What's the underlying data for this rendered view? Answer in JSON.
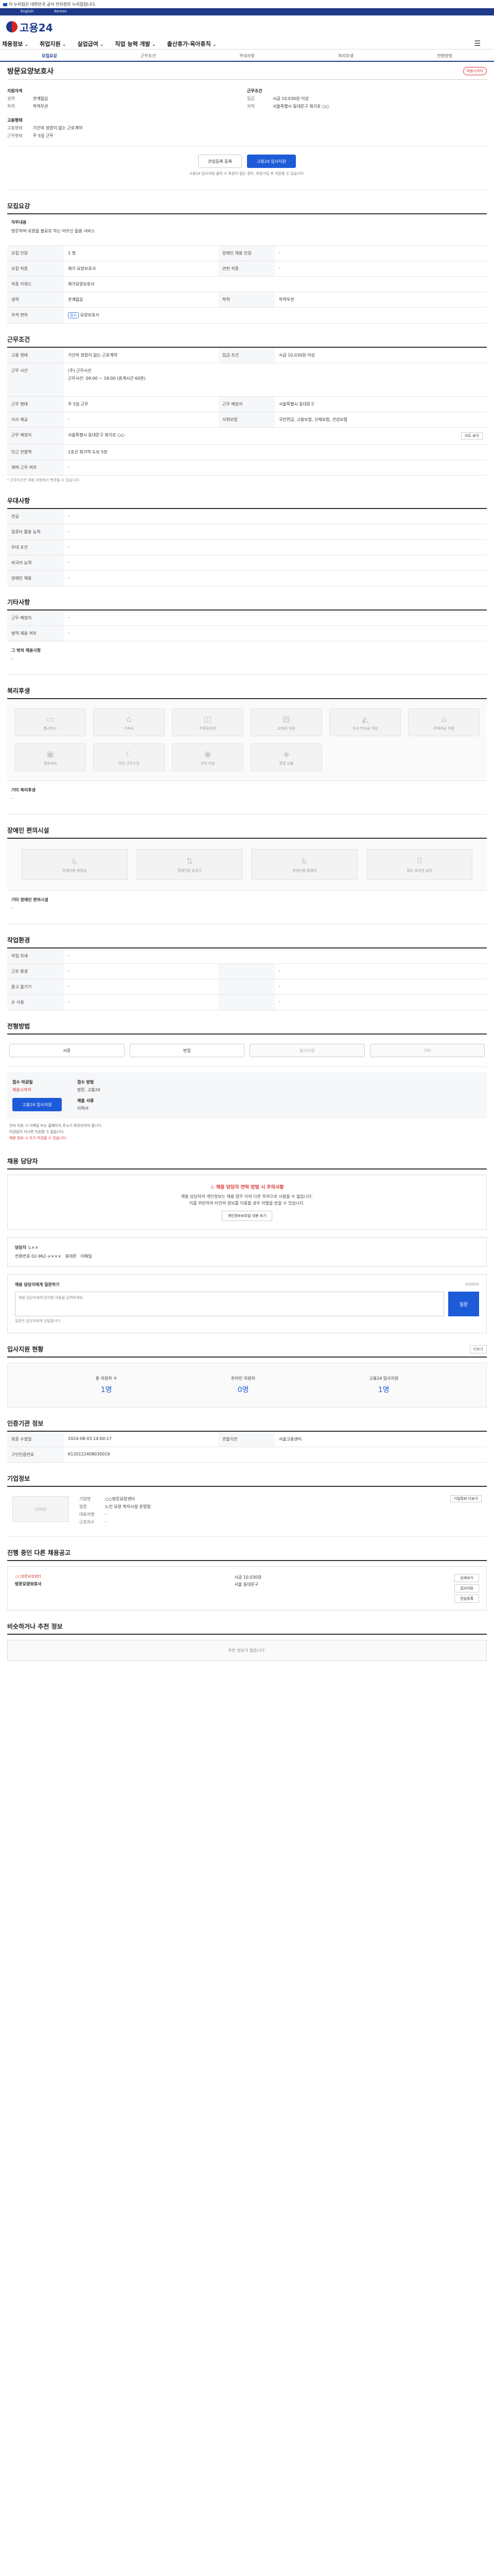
{
  "topbar": {
    "notice": "이 누리집은 대한민국 공식 전자정부 누리집입니다."
  },
  "lang": {
    "a": "English",
    "b": "Korean"
  },
  "header": {
    "logo": "고용24"
  },
  "nav": {
    "items": [
      "채용정보",
      "취업지원",
      "실업급여",
      "직업 능력 개발",
      "출산휴가·육아휴직"
    ]
  },
  "tabs": [
    "모집요강",
    "근무조건",
    "우대사항",
    "복리후생",
    "전형방법"
  ],
  "job": {
    "title": "방문요양보호사",
    "badge": "채용시까지",
    "left_head": "지원자격",
    "left": [
      [
        "경력",
        "관계없음"
      ],
      [
        "학력",
        "학력무관"
      ]
    ],
    "right_head": "근무조건",
    "right": [
      [
        "임금",
        "시급 10,030원 이상"
      ],
      [
        "지역",
        "서울특별시 동대문구 회기로 ○○"
      ]
    ],
    "left2_head": "고용형태",
    "left2": [
      [
        "고용형태",
        "기간의 정함이 없는 근로계약"
      ],
      [
        "근무형태",
        "주 5일 근무"
      ]
    ],
    "btn_interest": "관심등록 등록",
    "btn_apply": "고용24 입사지원",
    "note": "고용24 입사지원 클릭 시 회원이 없는 경우, 회원가입 후 지원할 수 있습니다."
  },
  "recruit": {
    "h": "모집요강",
    "t1_label": "직무내용",
    "t1_value": "방문하여 요양을 필요로 하는 어르신 돌봄 서비스",
    "rows": [
      [
        "모집 인원",
        "1 명",
        "장애인 채용 인원",
        "-"
      ],
      [
        "모집 직종",
        "재가 요양보호사",
        "관련 직종",
        "-"
      ],
      [
        "직종 키워드",
        "재가요양보호사",
        "",
        ""
      ],
      [
        "경력",
        "관계없음",
        "학력",
        "학력무관"
      ]
    ],
    "license_label": "자격 면허",
    "license": [
      "요양보호사"
    ]
  },
  "cond": {
    "h": "근무조건",
    "rows": [
      [
        "고용 형태",
        "기간의 정함이 없는 근로계약",
        "임금 조건",
        "시급 10,030원 이상"
      ]
    ],
    "time_label": "근무 시간",
    "time1": "(주) 근무시간",
    "time2": "근무시간: 09:00 ~ 18:00 (휴게시간 60분)",
    "rows2": [
      [
        "근무 형태",
        "주 5일 근무",
        "근무 예정지",
        "서울특별시 동대문구"
      ]
    ],
    "rows3": [
      [
        "식사 제공",
        "-",
        "사회보험",
        "국민연금, 고용보험, 산재보험, 건강보험"
      ],
      [
        "퇴직급여",
        "퇴직금",
        "",
        ""
      ]
    ],
    "place_label": "근무 예정지",
    "place": "서울특별시 동대문구 회기로 ○○",
    "map": "지도 보기",
    "station_label": "인근 전철역",
    "station": "1호선 회기역 도보 5분",
    "extra_label": "재택 근무 여부",
    "extra": "-",
    "note": "* 근무조건은 채용 과정에서 변경될 수 있습니다."
  },
  "pref": {
    "h": "우대사항",
    "rows": [
      [
        "전공",
        "-"
      ],
      [
        "컴퓨터 활용 능력",
        "-"
      ],
      [
        "우대 조건",
        "-"
      ],
      [
        "외국어 능력",
        "-"
      ],
      [
        "장애인 채용",
        "-"
      ]
    ]
  },
  "other": {
    "h": "기타사항",
    "rows": [
      [
        "근무 예정지",
        "-"
      ],
      [
        "병역 채용 여부",
        "-"
      ]
    ],
    "sub": "그 밖의 채용사항",
    "subv": "-"
  },
  "welfare": {
    "h": "복리후생",
    "tiles": [
      "통근버스",
      "기숙사",
      "차량유지비",
      "교육비 지원",
      "자녀 학자금 지원",
      "주택자금 지원",
      "경조사비",
      "야간 근무수당",
      "식비 지원",
      "명절 선물"
    ],
    "sub": "기타 복리후생",
    "subv": "-"
  },
  "disability": {
    "h": "장애인 편의시설",
    "tiles": [
      "장애인용 화장실",
      "장애인용 승강기",
      "장애인용 휠체어",
      "점자 표지판 설치"
    ],
    "sub": "기타 장애인 편의시설",
    "subv": "-"
  },
  "env": {
    "h": "작업환경",
    "rows": [
      [
        "작업 자세",
        "-",
        "",
        ""
      ],
      [
        "근로 환경",
        "-",
        "",
        "-"
      ],
      [
        "들고 옮기기",
        "-",
        "",
        "-"
      ],
      [
        "손 사용",
        "-",
        "",
        "-"
      ]
    ]
  },
  "method": {
    "h": "전형방법",
    "t": [
      "서류",
      "면접",
      "필기시험",
      "기타"
    ],
    "apply_label": "접수 마감일",
    "apply_v": "채용시까지",
    "apply_btn": "고용24 입사지원",
    "way_label": "접수 방법",
    "way_v": "방문, 고용24",
    "doc_label": "제출 서류",
    "doc_v": "이력서",
    "bullets": [
      "전자 지원 시 이메일 또는 홈페이지 주소가 확인되어야 합니다.",
      "마감일이 지나면 지원할 수 없습니다.",
      "채용 완료 시 조기 마감될 수 있습니다."
    ]
  },
  "manager": {
    "h": "채용 담당자",
    "warn": "채용 담당자 연락 방법 시 주의사항",
    "p1": "채용 담당자의 개인정보는 채용 업무 이외 다른 목적으로 사용할 수 없습니다.",
    "p2": "이를 위반하여 타인의 정보를 이용할 경우 처벌을 받을 수 있습니다.",
    "btn": "개인정보보호법 내용 보기",
    "name_label": "담당자",
    "name": "노××",
    "tel_label": "전화번호",
    "tel": "02-962-××××",
    "mobile": "휴대폰",
    "email": "이메일"
  },
  "qa": {
    "h": "채용 담당자에게 질문하기",
    "limit": "0/100자",
    "placeholder": "채용 담당자에게 문의할 내용을 입력하세요.",
    "submit": "질문",
    "note": "질문은 담당자에게 전달됩니다."
  },
  "status": {
    "h": "입사지원 현황",
    "a": "총 지원자 수",
    "av": "1명",
    "b": "온라인 지원자",
    "bv": "0명",
    "c": "고용24 입사지원",
    "cv": "1명",
    "more": "더보기"
  },
  "meta": {
    "h": "인증기관 정보",
    "reg_label": "최종 수정일",
    "reg": "2024-08-03 14:00:17",
    "agency_label": "관할기관",
    "agency": "서울고용센터",
    "no_label": "구인인증번호",
    "no": "K120122408030019"
  },
  "company": {
    "h": "기업정보",
    "logo": "LOGO",
    "rows": [
      [
        "기업명",
        "○○방문요양센터"
      ],
      [
        "업종",
        "노인 요양 복지시설 운영업"
      ],
      [
        "대표자명",
        "-"
      ],
      [
        "근로자수",
        "-"
      ]
    ],
    "link": "기업정보 더보기"
  },
  "others": {
    "h": "진행 중인 다른 채용공고",
    "company": "○○방문요양센터",
    "title": "방문요양보호사",
    "wage": "시급 10,030원",
    "place": "서울 동대문구",
    "btn1": "상세보기",
    "btn2": "입사지원",
    "btn3": "관심등록"
  },
  "similar": {
    "h": "비슷하거나 추천 정보",
    "empty": "추천 정보가 없습니다."
  },
  "colors": {
    "brand": "#1b3a8c",
    "primary": "#1e5bd8",
    "danger": "#d33"
  }
}
